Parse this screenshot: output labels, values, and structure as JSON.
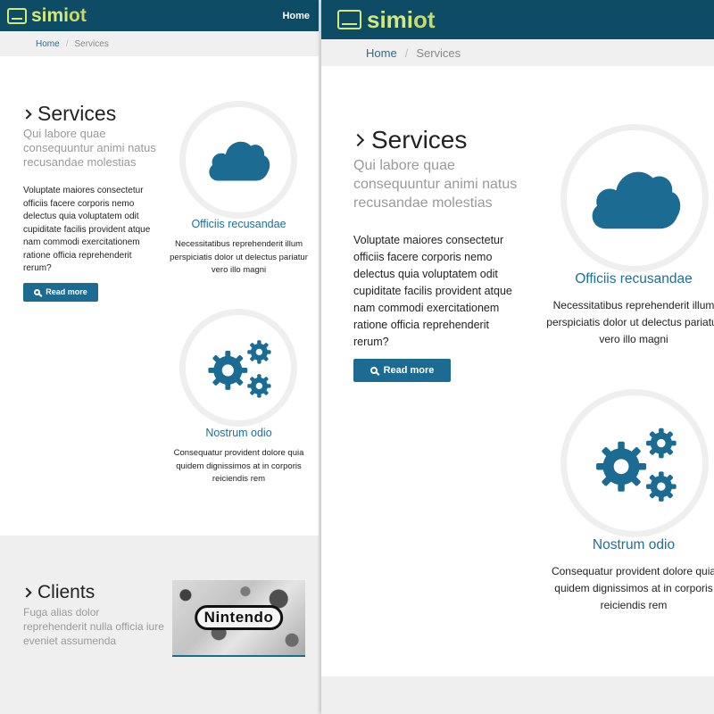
{
  "brand": {
    "name_dark": "simi",
    "name_light": "ot"
  },
  "nav": {
    "home_label": "Home"
  },
  "breadcrumb": {
    "home": "Home",
    "separator": "/",
    "current": "Services"
  },
  "services": {
    "title": "Services",
    "subtitle": "Qui labore quae consequuntur animi natus recusandae molestias",
    "body": "Voluptate maiores consectetur officiis facere corporis nemo delectus quia voluptatem odit cupiditate facilis provident atque nam commodi exercitationem ratione officia reprehenderit rerum?",
    "read_more": "Read more"
  },
  "features": [
    {
      "icon": "cloud-icon",
      "title": "Officiis recusandae",
      "text": "Necessitatibus reprehenderit illum perspiciatis dolor ut delectus pariatur vero illo magni"
    },
    {
      "icon": "gears-icon",
      "title": "Nostrum odio",
      "text": "Consequatur provident dolore quia quidem dignissimos at in corporis reiciendis rem"
    }
  ],
  "clients": {
    "title": "Clients",
    "subtitle": "Fuga alias dolor reprehenderit nulla officia iure eveniet assumenda",
    "logo_text": "Nintendo"
  },
  "colors": {
    "nav": "#0e4c66",
    "accent": "#1b6b93",
    "logo": "#d5e87a"
  }
}
